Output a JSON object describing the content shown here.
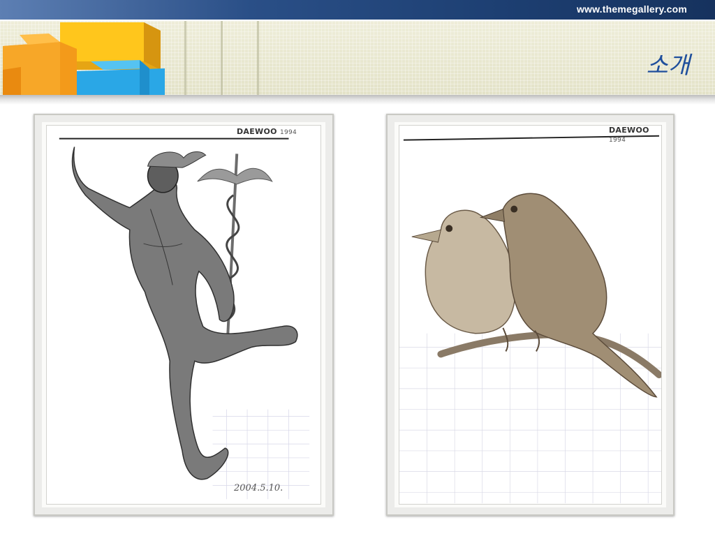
{
  "header": {
    "site_url": "www.themegallery.com",
    "title": "소개",
    "colors": {
      "top_bar": "#1d3f72",
      "band": "#e9e8d2",
      "title": "#1f4f9c"
    }
  },
  "logo": {
    "name": "puzzle-blocks-logo",
    "colors": [
      "#f7a21b",
      "#ffc81f",
      "#29a9e6"
    ]
  },
  "artworks": [
    {
      "subject": "Hermes pencil drawing",
      "brand": "DAEWOO",
      "year": "1994",
      "date_note": "2004.5.10."
    },
    {
      "subject": "Two birds on a branch pencil drawing",
      "brand": "DAEWOO",
      "year": "1994"
    }
  ]
}
